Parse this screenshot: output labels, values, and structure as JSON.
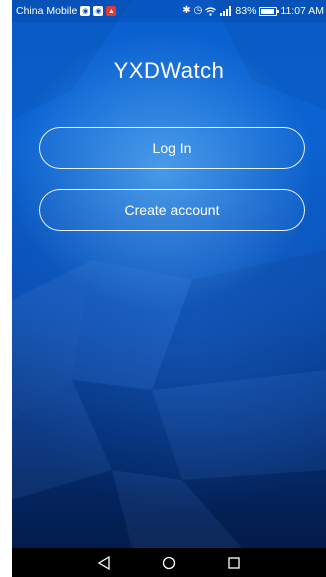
{
  "status_bar": {
    "carrier": "China Mobile",
    "battery_text": "83%",
    "time": "11:07 AM",
    "icons": [
      "notification-app-icon",
      "notification-app-icon",
      "notification-red-icon",
      "bluetooth-icon",
      "alarm-icon",
      "wifi-icon",
      "signal-4g-icon",
      "battery-icon"
    ]
  },
  "app": {
    "title": "YXDWatch",
    "login_label": "Log In",
    "create_label": "Create account"
  },
  "nav_bar": {
    "icons": [
      "back-icon",
      "home-icon",
      "recents-icon"
    ]
  },
  "colors": {
    "background_top": "#0b63d2",
    "background_bottom": "#041f52",
    "nav_bar": "#000000",
    "text": "#ffffff"
  }
}
